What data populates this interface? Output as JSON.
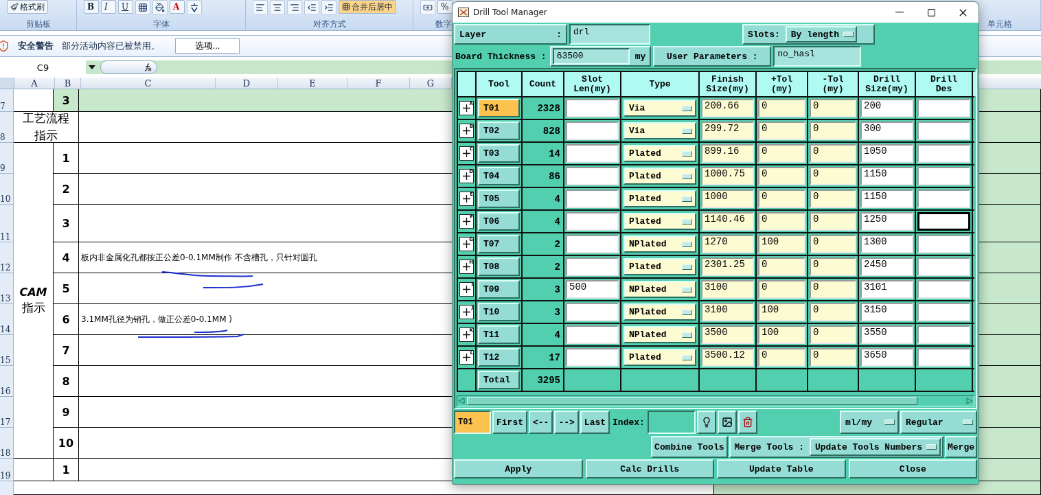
{
  "ribbon": {
    "groups": [
      {
        "label": "剪贴板",
        "tools": [
          {
            "kind": "brush",
            "label": "格式刷"
          }
        ]
      },
      {
        "label": "字体",
        "tools": [
          {
            "kind": "bold",
            "label": "B"
          },
          {
            "kind": "italic",
            "label": "I"
          },
          {
            "kind": "underline",
            "label": "U"
          },
          {
            "kind": "border"
          },
          {
            "kind": "fill"
          },
          {
            "kind": "font-color",
            "label": "A"
          },
          {
            "kind": "phonetic"
          }
        ]
      },
      {
        "label": "对齐方式",
        "tools": [
          {
            "kind": "align-left"
          },
          {
            "kind": "align-center"
          },
          {
            "kind": "align-right"
          },
          {
            "kind": "indent-less"
          },
          {
            "kind": "indent-more"
          },
          {
            "kind": "merge",
            "label": "合并后居中"
          }
        ]
      },
      {
        "label": "数字",
        "tools": [
          {
            "kind": "money"
          },
          {
            "kind": "percent",
            "label": "%"
          }
        ]
      },
      {
        "label": "单元格"
      }
    ]
  },
  "security_bar": {
    "title": "安全警告",
    "message": "部分活动内容已被禁用。",
    "button": "选项..."
  },
  "formula_bar": {
    "name_box": "C9"
  },
  "sheet": {
    "columns": [
      "A",
      "B",
      "C",
      "D",
      "E",
      "F",
      "G"
    ],
    "blocks": [
      {
        "kind": "item",
        "rows": [
          {
            "num": "7",
            "item": "3",
            "highlighted": true
          }
        ]
      },
      {
        "kind": "merged",
        "label_lines": [
          "工艺流程",
          "指示"
        ],
        "rows": [
          {
            "num": "8",
            "highlighted": false
          }
        ]
      },
      {
        "kind": "item",
        "label_lines": [
          "CAM",
          "指示"
        ],
        "rows": [
          {
            "num": "9",
            "item": "1",
            "highlighted": false
          },
          {
            "num": "10",
            "item": "2",
            "highlighted": false
          },
          {
            "num": "11",
            "item": "3",
            "highlighted": false
          },
          {
            "num": "12",
            "item": "4",
            "text": "板内非金属化孔都按正公差0-0.1MM制作 不含槽孔，只针对圆孔",
            "highlighted": false
          },
          {
            "num": "13",
            "item": "5",
            "highlighted": false
          },
          {
            "num": "14",
            "item": "6",
            "text": "3.1MM孔径为销孔，做正公差0-0.1MM )",
            "highlighted": false
          },
          {
            "num": "15",
            "item": "7",
            "highlighted": false
          },
          {
            "num": "16",
            "item": "8",
            "highlighted": false
          },
          {
            "num": "17",
            "item": "9",
            "highlighted": false
          },
          {
            "num": "18",
            "item": "10",
            "highlighted": false
          }
        ]
      },
      {
        "kind": "item",
        "rows": [
          {
            "num": "19",
            "item": "1",
            "highlighted": false
          }
        ]
      }
    ]
  },
  "dialog": {
    "title": "Drill Tool Manager",
    "layer": {
      "label": "Layer",
      "colon": ":",
      "value": "drl"
    },
    "slots": {
      "label": "Slots:",
      "value": "By length"
    },
    "board_thickness": {
      "label": "Board Thickness :",
      "value": "63500",
      "unit": "my"
    },
    "user_parameters": {
      "label": "User Parameters :",
      "value": "no_hasl"
    },
    "table": {
      "columns": [
        {
          "lines": [
            "Tool"
          ]
        },
        {
          "lines": [
            "Count"
          ]
        },
        {
          "lines": [
            "Slot",
            "Len(my)"
          ]
        },
        {
          "lines": [
            "Type"
          ]
        },
        {
          "lines": [
            "Finish",
            "Size(my)"
          ]
        },
        {
          "lines": [
            "+Tol",
            "(my)"
          ]
        },
        {
          "lines": [
            "-Tol",
            "(my)"
          ]
        },
        {
          "lines": [
            "Drill",
            "Size(my)"
          ]
        },
        {
          "lines": [
            "Drill",
            "Des"
          ]
        }
      ],
      "rows": [
        {
          "letter": "A",
          "tool": "T01",
          "selected": true,
          "count": "2328",
          "type": "Via",
          "finish": "200.66",
          "plus_tol": "0",
          "minus_tol": "0",
          "drill_size": "200",
          "focused": false
        },
        {
          "letter": "B",
          "tool": "T02",
          "selected": false,
          "count": "828",
          "type": "Via",
          "finish": "299.72",
          "plus_tol": "0",
          "minus_tol": "0",
          "drill_size": "300",
          "focused": false
        },
        {
          "letter": "C",
          "tool": "T03",
          "selected": false,
          "count": "14",
          "type": "Plated",
          "finish": "899.16",
          "plus_tol": "0",
          "minus_tol": "0",
          "drill_size": "1050",
          "focused": false
        },
        {
          "letter": "D",
          "tool": "T04",
          "selected": false,
          "count": "86",
          "type": "Plated",
          "finish": "1000.75",
          "plus_tol": "0",
          "minus_tol": "0",
          "drill_size": "1150",
          "focused": false
        },
        {
          "letter": "E",
          "tool": "T05",
          "selected": false,
          "count": "4",
          "type": "Plated",
          "finish": "1000",
          "plus_tol": "0",
          "minus_tol": "0",
          "drill_size": "1150",
          "focused": false
        },
        {
          "letter": "F",
          "tool": "T06",
          "selected": false,
          "count": "4",
          "type": "Plated",
          "finish": "1140.46",
          "plus_tol": "0",
          "minus_tol": "0",
          "drill_size": "1250",
          "focused": true
        },
        {
          "letter": "G",
          "tool": "T07",
          "selected": false,
          "count": "2",
          "type": "NPlated",
          "finish": "1270",
          "plus_tol": "100",
          "minus_tol": "0",
          "drill_size": "1300",
          "focused": false
        },
        {
          "letter": "H",
          "tool": "T08",
          "selected": false,
          "count": "2",
          "type": "Plated",
          "finish": "2301.25",
          "plus_tol": "0",
          "minus_tol": "0",
          "drill_size": "2450",
          "focused": false
        },
        {
          "letter": "I",
          "tool": "T09",
          "selected": false,
          "count": "3",
          "slot_len": "500",
          "type": "NPlated",
          "finish": "3100",
          "plus_tol": "0",
          "minus_tol": "0",
          "drill_size": "3101",
          "focused": false
        },
        {
          "letter": "J",
          "tool": "T10",
          "selected": false,
          "count": "3",
          "type": "NPlated",
          "finish": "3100",
          "plus_tol": "100",
          "minus_tol": "0",
          "drill_size": "3150",
          "focused": false
        },
        {
          "letter": "K",
          "tool": "T11",
          "selected": false,
          "count": "4",
          "type": "NPlated",
          "finish": "3500",
          "plus_tol": "100",
          "minus_tol": "0",
          "drill_size": "3550",
          "focused": false
        },
        {
          "letter": "L",
          "tool": "T12",
          "selected": false,
          "count": "17",
          "type": "Plated",
          "finish": "3500.12",
          "plus_tol": "0",
          "minus_tol": "0",
          "drill_size": "3650",
          "focused": false
        }
      ],
      "total": {
        "label": "Total",
        "count": "3295"
      }
    },
    "nav": {
      "current": "T01",
      "buttons": [
        "First",
        "<--",
        "-->",
        "Last"
      ],
      "index_label": "Index:",
      "unit": "ml/my",
      "mode": "Regular"
    },
    "merge": {
      "combine": "Combine Tools",
      "label": "Merge Tools :",
      "option": "Update Tools Numbers",
      "button": "Merge"
    },
    "actions": [
      "Apply",
      "Calc Drills",
      "Update Table",
      "Close"
    ]
  }
}
